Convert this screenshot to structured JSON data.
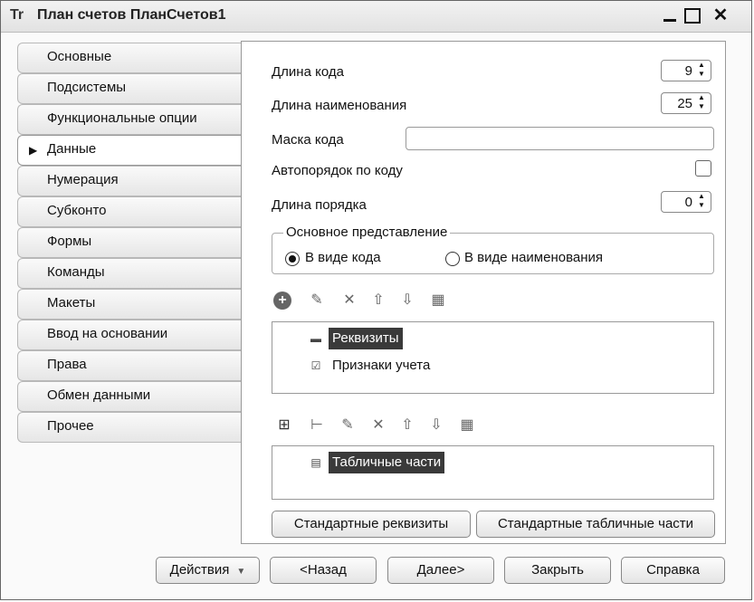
{
  "window": {
    "title": "План счетов ПланСчетов1",
    "app_icon": "Tr",
    "close_glyph": "✕"
  },
  "tabs": [
    {
      "label": "Основные",
      "active": false
    },
    {
      "label": "Подсистемы",
      "active": false
    },
    {
      "label": "Функциональные опции",
      "active": false
    },
    {
      "label": "Данные",
      "active": true
    },
    {
      "label": "Нумерация",
      "active": false
    },
    {
      "label": "Субконто",
      "active": false
    },
    {
      "label": "Формы",
      "active": false
    },
    {
      "label": "Команды",
      "active": false
    },
    {
      "label": "Макеты",
      "active": false
    },
    {
      "label": "Ввод на основании",
      "active": false
    },
    {
      "label": "Права",
      "active": false
    },
    {
      "label": "Обмен данными",
      "active": false
    },
    {
      "label": "Прочее",
      "active": false
    }
  ],
  "data_panel": {
    "code_length": {
      "label": "Длина кода",
      "value": "9"
    },
    "name_length": {
      "label": "Длина наименования",
      "value": "25"
    },
    "code_mask": {
      "label": "Маска кода",
      "value": ""
    },
    "auto_order": {
      "label": "Автопорядок по коду",
      "checked": false
    },
    "order_length": {
      "label": "Длина порядка",
      "value": "0"
    },
    "main_presentation": {
      "title": "Основное представление",
      "options": [
        {
          "label": "В виде кода",
          "selected": true
        },
        {
          "label": "В виде наименования",
          "selected": false
        }
      ]
    },
    "attributes_tree": [
      {
        "label": "Реквизиты",
        "selected": true,
        "icon": "minus-icon"
      },
      {
        "label": "Признаки учета",
        "selected": false,
        "icon": "checkbox-attribute-icon"
      }
    ],
    "tabular_tree": [
      {
        "label": "Табличные части",
        "selected": true,
        "icon": "table-icon"
      }
    ],
    "standard_attributes_button": "Стандартные реквизиты",
    "standard_tabular_button": "Стандартные табличные части"
  },
  "footer": {
    "actions": "Действия",
    "back": "<Назад",
    "next": "Далее>",
    "close": "Закрыть",
    "help": "Справка"
  },
  "icons": {
    "add": "+",
    "edit": "✎",
    "delete": "✕",
    "move_up": "⇧",
    "move_down": "⇩",
    "list": "▦",
    "add_table": "⊞",
    "add_column": "⊢"
  }
}
